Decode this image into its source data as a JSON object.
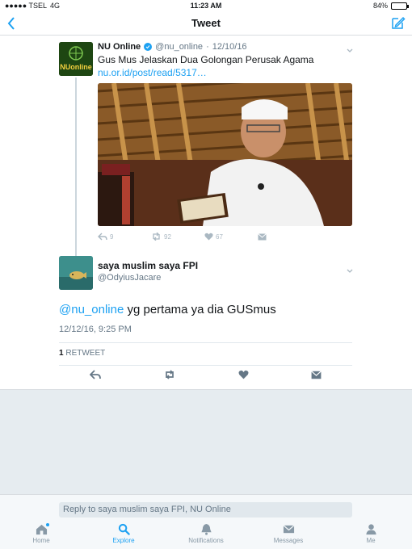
{
  "status_bar": {
    "carrier": "●●●●● TSEL",
    "network": "4G",
    "time": "11:23 AM",
    "battery_text": "84%",
    "battery_level": 0.84
  },
  "nav": {
    "title": "Tweet"
  },
  "quoted_tweet": {
    "name": "NU Online",
    "handle": "@nu_online",
    "date": "12/10/16",
    "text": "Gus Mus Jelaskan Dua Golongan Perusak Agama",
    "link": "nu.or.id/post/read/5317…",
    "avatar_text": "NUonline",
    "reply_count": "9",
    "retweet_count": "92",
    "like_count": "67"
  },
  "main_tweet": {
    "name": "saya muslim saya FPI",
    "handle": "@OdyiusJacare",
    "mention": "@nu_online",
    "body": " yg pertama ya dia GUSmus",
    "timestamp": "12/12/16, 9:25 PM",
    "retweets_count": "1",
    "retweets_label": " RETWEET"
  },
  "reply": {
    "placeholder": "Reply to saya muslim saya FPI, NU Online"
  },
  "tabs": [
    {
      "label": "Home"
    },
    {
      "label": "Explore"
    },
    {
      "label": "Notifications"
    },
    {
      "label": "Messages"
    },
    {
      "label": "Me"
    }
  ],
  "colors": {
    "accent": "#1da1f2",
    "text": "#14171a",
    "muted": "#657786",
    "background_gray": "#e6ecf0"
  }
}
